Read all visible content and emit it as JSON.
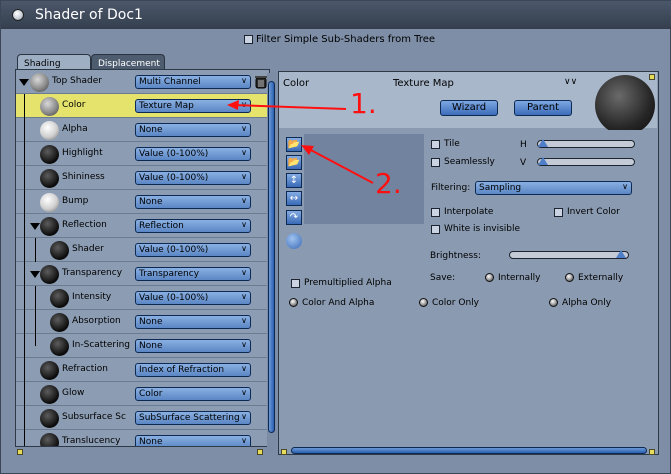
{
  "window": {
    "title": "Shader of Doc1"
  },
  "filter": {
    "label": "Filter Simple Sub-Shaders from Tree"
  },
  "tabs": [
    {
      "label": "Shading",
      "active": true
    },
    {
      "label": "Displacement",
      "active": false
    }
  ],
  "tree": [
    {
      "label": "Top Shader",
      "value": "Multi Channel"
    },
    {
      "label": "Color",
      "value": "Texture Map"
    },
    {
      "label": "Alpha",
      "value": "None"
    },
    {
      "label": "Highlight",
      "value": "Value (0-100%)"
    },
    {
      "label": "Shininess",
      "value": "Value (0-100%)"
    },
    {
      "label": "Bump",
      "value": "None"
    },
    {
      "label": "Reflection",
      "value": "Reflection"
    },
    {
      "label": "Shader",
      "value": "Value (0-100%)"
    },
    {
      "label": "Transparency",
      "value": "Transparency"
    },
    {
      "label": "Intensity",
      "value": "Value (0-100%)"
    },
    {
      "label": "Absorption",
      "value": "None"
    },
    {
      "label": "In-Scattering",
      "value": "None"
    },
    {
      "label": "Refraction",
      "value": "Index of Refraction"
    },
    {
      "label": "Glow",
      "value": "Color"
    },
    {
      "label": "Subsurface Sc",
      "value": "SubSurface Scattering"
    },
    {
      "label": "Translucency",
      "value": "None"
    }
  ],
  "header": {
    "channel": "Color",
    "type": "Texture Map",
    "wizard": "Wizard",
    "parent": "Parent"
  },
  "options": {
    "tile": "Tile",
    "h": "H",
    "seamlessly": "Seamlessly",
    "v": "V",
    "filtering_label": "Filtering:",
    "filtering_value": "Sampling",
    "interpolate": "Interpolate",
    "invert_color": "Invert Color",
    "white_invisible": "White is invisible",
    "brightness": "Brightness:",
    "premultiplied": "Premultiplied Alpha",
    "save_label": "Save:",
    "internally": "Internally",
    "externally": "Externally",
    "color_and_alpha": "Color And Alpha",
    "color_only": "Color Only",
    "alpha_only": "Alpha Only"
  },
  "annotations": {
    "one": "1.",
    "two": "2."
  }
}
